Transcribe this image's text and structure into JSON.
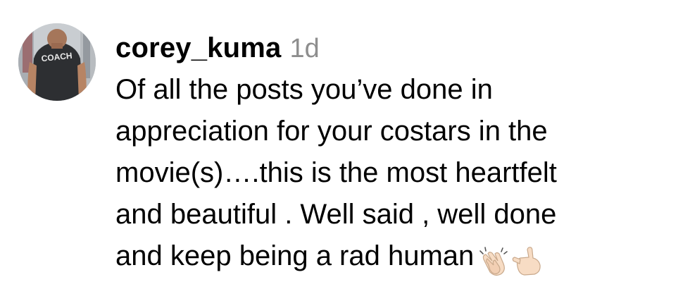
{
  "comment": {
    "username": "corey_kuma",
    "timestamp": "1d",
    "avatar_shirt_text": "COACH",
    "text_lines": [
      "Of all the posts you’ve done in",
      "appreciation for your costars in the",
      "movie(s)….this is the most heartfelt",
      "and beautiful . Well said , well done",
      "and keep being a rad human"
    ],
    "emojis": [
      "clapping-hands-icon",
      "call-me-hand-icon"
    ],
    "colors": {
      "username": "#000000",
      "timestamp": "#8e8e8e",
      "text": "#000000",
      "skin_tone": "#f7dcc4"
    }
  }
}
